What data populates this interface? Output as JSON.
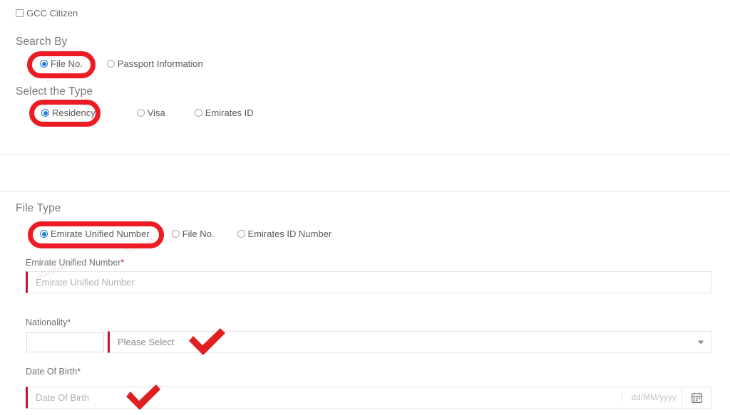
{
  "form": {
    "gcc_checkbox": {
      "label": "GCC Citizen",
      "checked": false
    },
    "search_by": {
      "title": "Search By",
      "options": [
        {
          "label": "File No.",
          "selected": true
        },
        {
          "label": "Passport Information",
          "selected": false
        }
      ]
    },
    "select_type": {
      "title": "Select the Type",
      "options": [
        {
          "label": "Residency",
          "selected": true
        },
        {
          "label": "Visa",
          "selected": false
        },
        {
          "label": "Emirates ID",
          "selected": false
        }
      ]
    },
    "file_type": {
      "title": "File Type",
      "options": [
        {
          "label": "Emirate Unified Number",
          "selected": true
        },
        {
          "label": "File No.",
          "selected": false
        },
        {
          "label": "Emirates ID Number",
          "selected": false
        }
      ]
    },
    "unified_number": {
      "label": "Emirate Unified Number",
      "required_mark": "*",
      "placeholder": "Emirate Unified Number",
      "value": ""
    },
    "nationality": {
      "label": "Nationality*",
      "code_value": "",
      "selected_option": "Please Select",
      "caret_icon": "chevron-down-icon"
    },
    "date_of_birth": {
      "label": "Date Of Birth*",
      "placeholder": "Date Of Birth",
      "value": "",
      "format_hint": "dd/MM/yyyy",
      "calendar_icon": "calendar-icon"
    }
  },
  "annotations": {
    "highlight_color": "#ed1c24",
    "ovals": [
      {
        "name": "highlight-file-no"
      },
      {
        "name": "highlight-residency"
      },
      {
        "name": "highlight-emirate-unified-number"
      }
    ],
    "checks": [
      {
        "name": "check-nationality"
      },
      {
        "name": "check-date-of-birth"
      }
    ]
  },
  "watermark": {
    "text": "abudhabi"
  }
}
